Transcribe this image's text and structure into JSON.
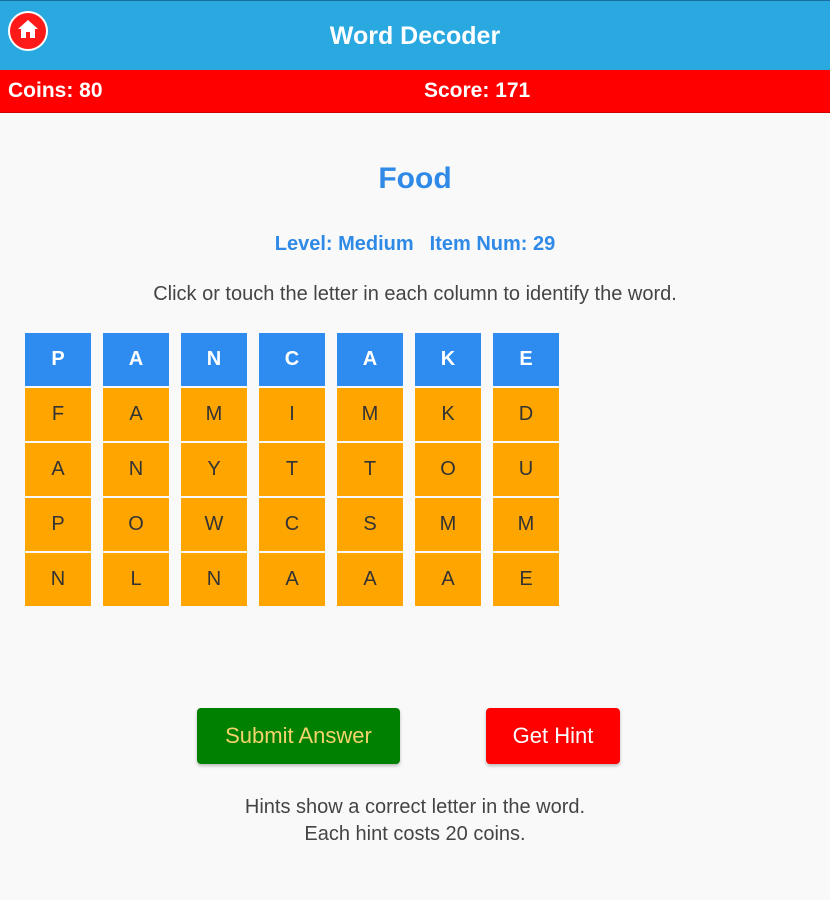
{
  "app": {
    "title": "Word Decoder"
  },
  "stats": {
    "coins": "Coins: 80",
    "score": "Score: 171"
  },
  "puzzle": {
    "category": "Food",
    "level": "Level: Medium",
    "item": "Item Num: 29",
    "instruction": "Click or touch the letter in each column to identify the word.",
    "columns": [
      {
        "selected": "P",
        "options": [
          "F",
          "A",
          "P",
          "N"
        ]
      },
      {
        "selected": "A",
        "options": [
          "A",
          "N",
          "O",
          "L"
        ]
      },
      {
        "selected": "N",
        "options": [
          "M",
          "Y",
          "W",
          "N"
        ]
      },
      {
        "selected": "C",
        "options": [
          "I",
          "T",
          "C",
          "A"
        ]
      },
      {
        "selected": "A",
        "options": [
          "M",
          "T",
          "S",
          "A"
        ]
      },
      {
        "selected": "K",
        "options": [
          "K",
          "O",
          "M",
          "A"
        ]
      },
      {
        "selected": "E",
        "options": [
          "D",
          "U",
          "M",
          "E"
        ]
      }
    ]
  },
  "buttons": {
    "submit": "Submit Answer",
    "hint": "Get Hint"
  },
  "notes": {
    "line1": "Hints show a correct letter in the word.",
    "line2": "Each hint costs 20 coins."
  },
  "icons": {
    "home": "home-icon"
  },
  "colors": {
    "header": "#2aa8e0",
    "statusbar": "#ff0000",
    "accent_blue": "#2e8ae6",
    "tile_selected": "#2e8cf0",
    "tile_option": "#ffa500",
    "submit": "#008000",
    "hint": "#ff0000"
  }
}
